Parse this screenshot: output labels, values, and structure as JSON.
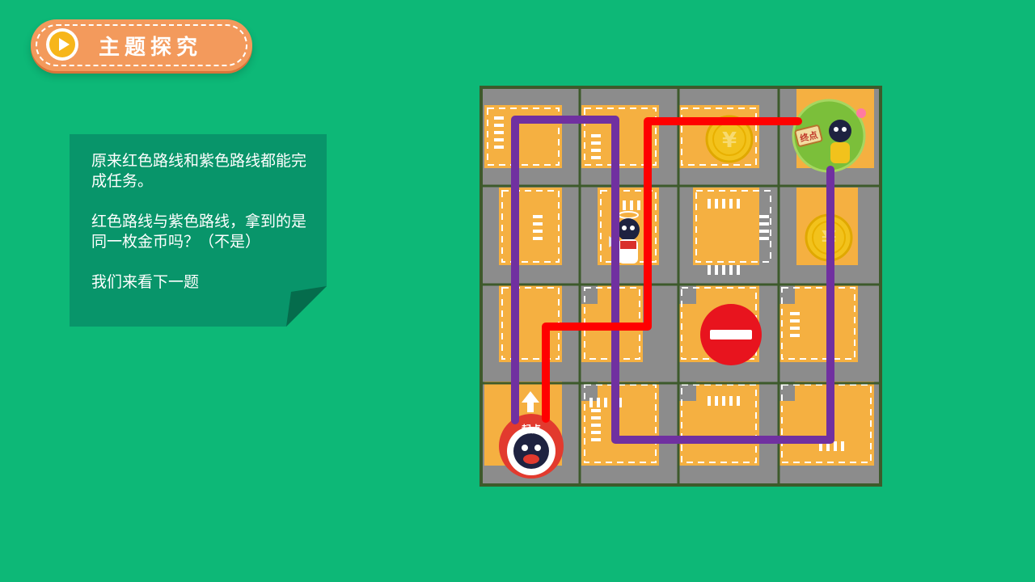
{
  "topic_badge": {
    "title": "主题探究",
    "icon": "play-icon"
  },
  "note": {
    "line1": "原来红色路线和紫色路线都能完成任务。",
    "line2_main": "红色路线与紫色路线，拿到的是同一枚金币吗？",
    "line2_hint": "（不是）",
    "line3": "我们来看下一题"
  },
  "maze": {
    "start_label": "起点",
    "end_label": "终点",
    "coin_symbol": "¥",
    "routes": {
      "red": "#ff0000",
      "purple": "#7030a0"
    },
    "colors": {
      "road": "#8c8c8c",
      "block": "#f5b041",
      "grid": "#3d5a2b",
      "no_entry": "#e8141e"
    }
  }
}
